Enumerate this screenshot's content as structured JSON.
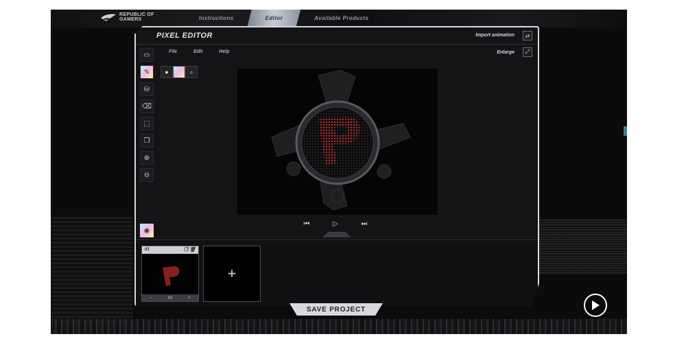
{
  "brand": {
    "logo_text": "REPUBLIC OF GAMERS"
  },
  "nav": {
    "tabs": [
      {
        "label": "Instructions",
        "active": false
      },
      {
        "label": "Editor",
        "active": true
      },
      {
        "label": "Available Products",
        "active": false
      }
    ]
  },
  "editor": {
    "title": "PIXEL EDITOR",
    "import_label": "Import animation",
    "enlarge_label": "Enlarge",
    "menu": [
      "File",
      "Edit",
      "Help"
    ],
    "tools": [
      "image-icon",
      "pencil-icon",
      "fill-icon",
      "eraser-icon",
      "select-icon",
      "copy-icon",
      "zoom-in-icon",
      "zoom-out-icon"
    ],
    "active_tool": "pencil-icon"
  },
  "timeline": {
    "frames": [
      {
        "label": "01"
      }
    ],
    "add_symbol": "+",
    "frame_minus": "−",
    "frame_plus": "+",
    "frame_speed": "4x"
  },
  "actions": {
    "save_label": "SAVE PROJECT"
  },
  "colors": {
    "accent": "#d9dbe0",
    "pixel_red": "#c0302a",
    "background": "#0b0b0c"
  }
}
